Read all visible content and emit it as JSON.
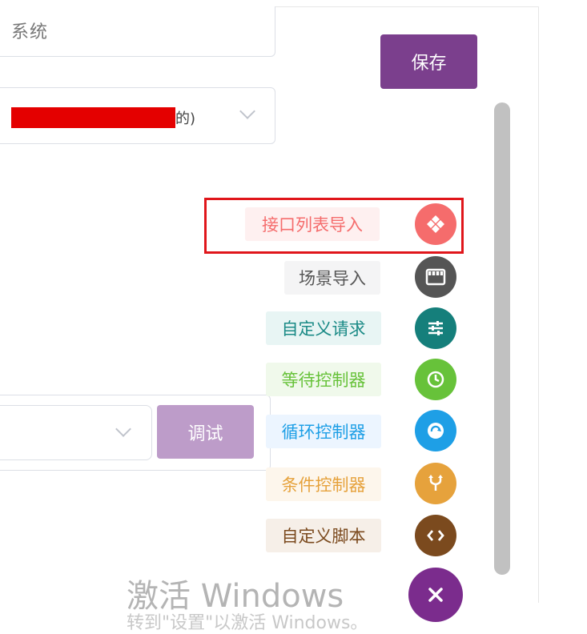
{
  "form": {
    "top_field_partial_text": "系统",
    "project_select_suffix": "的)",
    "save_label": "保存",
    "debug_label": "调试"
  },
  "fab_menu": {
    "items": [
      {
        "label": "接口列表导入",
        "icon": "api-import-icon",
        "text_color": "#f56c6c",
        "bg_color": "#fef0f0",
        "circle_color": "#f56c6c"
      },
      {
        "label": "场景导入",
        "icon": "film-icon",
        "text_color": "#555555",
        "bg_color": "#f4f4f5",
        "circle_color": "#555555"
      },
      {
        "label": "自定义请求",
        "icon": "sliders-icon",
        "text_color": "#1a8a86",
        "bg_color": "#e8f5f4",
        "circle_color": "#157f7b"
      },
      {
        "label": "等待控制器",
        "icon": "clock-icon",
        "text_color": "#67c23a",
        "bg_color": "#f0f9eb",
        "circle_color": "#67c23a"
      },
      {
        "label": "循环控制器",
        "icon": "loop-icon",
        "text_color": "#1e9fe6",
        "bg_color": "#ecf5ff",
        "circle_color": "#1e9fe6"
      },
      {
        "label": "条件控制器",
        "icon": "branch-icon",
        "text_color": "#e6a23c",
        "bg_color": "#fdf6ec",
        "circle_color": "#e6a23c"
      },
      {
        "label": "自定义脚本",
        "icon": "code-icon",
        "text_color": "#7b4a1e",
        "bg_color": "#f6efe8",
        "circle_color": "#7b4a1e"
      }
    ],
    "close_icon": "close-icon"
  },
  "watermark": {
    "line1": "激活 Windows",
    "line2": "转到\"设置\"以激活 Windows。"
  },
  "colors": {
    "brand_purple": "#7b3f8d",
    "highlight_red": "#e0161b"
  }
}
